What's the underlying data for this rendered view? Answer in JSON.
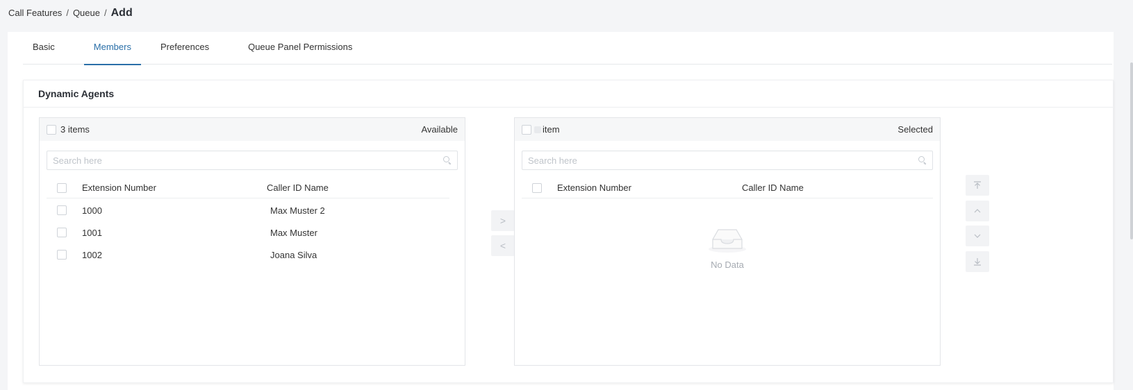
{
  "breadcrumb": {
    "items": [
      "Call Features",
      "Queue"
    ],
    "current": "Add",
    "separator": "/"
  },
  "tabs": [
    {
      "label": "Basic",
      "active": false
    },
    {
      "label": "Members",
      "active": true
    },
    {
      "label": "Preferences",
      "active": false
    },
    {
      "label": "Queue Panel Permissions",
      "active": false
    }
  ],
  "section": {
    "title": "Dynamic Agents"
  },
  "available": {
    "count": "3 items",
    "title": "Available",
    "search_placeholder": "Search here",
    "columns": {
      "ext": "Extension Number",
      "name": "Caller ID Name"
    },
    "rows": [
      {
        "ext": "1000",
        "name": "Max Muster 2"
      },
      {
        "ext": "1001",
        "name": "Max Muster"
      },
      {
        "ext": "1002",
        "name": "Joana Silva"
      }
    ]
  },
  "selected": {
    "count": "item",
    "title": "Selected",
    "search_placeholder": "Search here",
    "columns": {
      "ext": "Extension Number",
      "name": "Caller ID Name"
    },
    "empty_text": "No Data"
  },
  "transfer_buttons": {
    "to_right": ">",
    "to_left": "<"
  },
  "order_buttons": [
    "move-top",
    "move-up",
    "move-down",
    "move-bottom"
  ],
  "colors": {
    "accent": "#2a6fa8",
    "background": "#f4f5f7"
  }
}
